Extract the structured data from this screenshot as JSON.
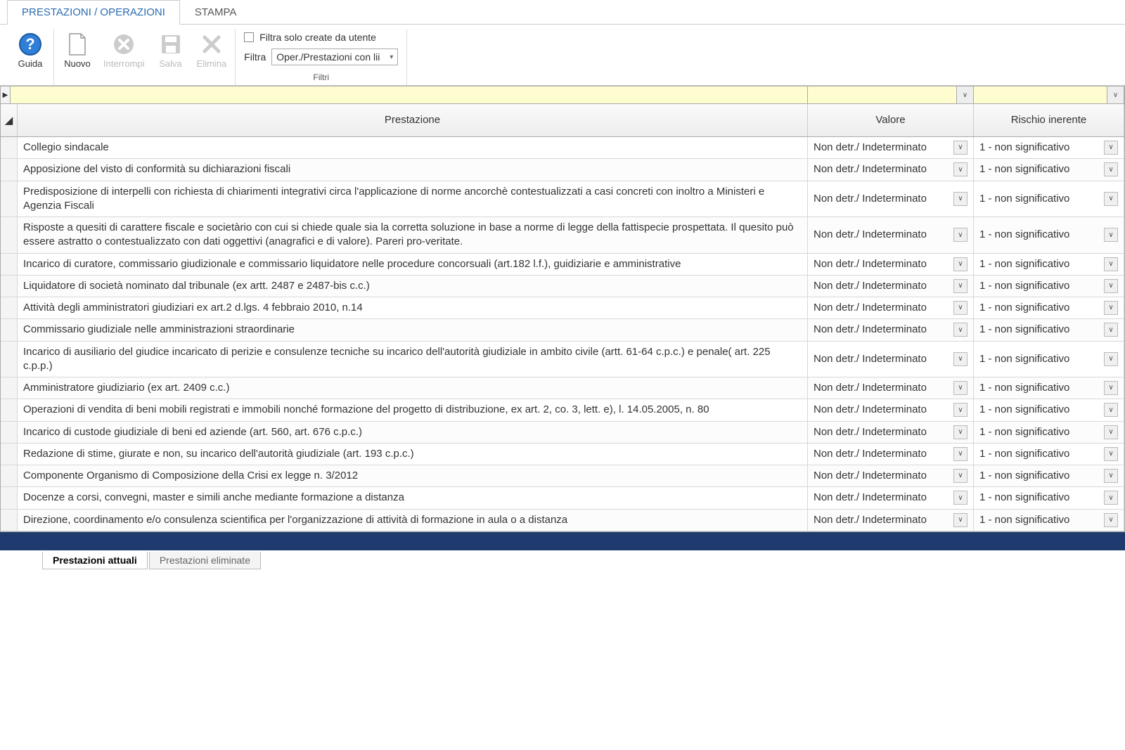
{
  "tabs": {
    "active": "PRESTAZIONI / OPERAZIONI",
    "other": "STAMPA"
  },
  "ribbon": {
    "guide": "Guida",
    "new": "Nuovo",
    "stop": "Interrompi",
    "save": "Salva",
    "delete": "Elimina",
    "filter_checkbox": "Filtra solo create da utente",
    "filter_label": "Filtra",
    "filter_value": "Oper./Prestazioni con lii",
    "filter_group": "Filtri"
  },
  "columns": {
    "prestazione": "Prestazione",
    "valore": "Valore",
    "rischio": "Rischio inerente"
  },
  "valDefault": "Non detr./ Indeterminato",
  "riskDefault": "1 - non significativo",
  "rows": [
    "Collegio sindacale",
    "Apposizione del visto di conformità su dichiarazioni fiscali",
    "Predisposizione di interpelli con richiesta di chiarimenti integrativi circa l'applicazione di norme ancorchè contestualizzati a casi concreti con inoltro a Ministeri e Agenzia Fiscali",
    "Risposte a quesiti di carattere fiscale e societàrio con cui si chiede quale sia la corretta soluzione in base a norme di legge della fattispecie prospettata. Il quesito può essere astratto o contestualizzato con dati oggettivi (anagrafici e di valore). Pareri pro-veritate.",
    "Incarico  di curatore, commissario giudizionale e commissario liquidatore nelle procedure concorsuali (art.182 l.f.), guidiziarie e amministrative",
    "Liquidatore di società nominato dal tribunale (ex artt. 2487 e 2487-bis c.c.)",
    "Attività degli amministratori giudiziari ex art.2 d.lgs. 4 febbraio 2010, n.14",
    "Commissario giudiziale nelle amministrazioni straordinarie",
    "Incarico di ausiliario del giudice incaricato di perizie e consulenze tecniche su incarico dell'autorità giudiziale in ambito civile (artt. 61-64 c.p.c.) e penale( art. 225 c.p.p.)",
    "Amministratore giudiziario (ex art. 2409 c.c.)",
    "Operazioni di vendita di beni mobili registrati e immobili nonché formazione del progetto di distribuzione, ex art. 2, co. 3, lett. e), l. 14.05.2005, n. 80",
    "Incarico di custode giudiziale di beni ed aziende (art. 560, art. 676 c.p.c.)",
    "Redazione di stime, giurate e non, su incarico dell'autorità giudiziale (art. 193 c.p.c.)",
    "Componente Organismo di Composizione della Crisi ex legge n. 3/2012",
    "Docenze a corsi, convegni, master e simili anche mediante formazione a distanza",
    "Direzione, coordinamento e/o consulenza scientifica per l'organizzazione di attività di formazione in aula o a distanza"
  ],
  "bottomTabs": {
    "active": "Prestazioni attuali",
    "other": "Prestazioni eliminate"
  }
}
